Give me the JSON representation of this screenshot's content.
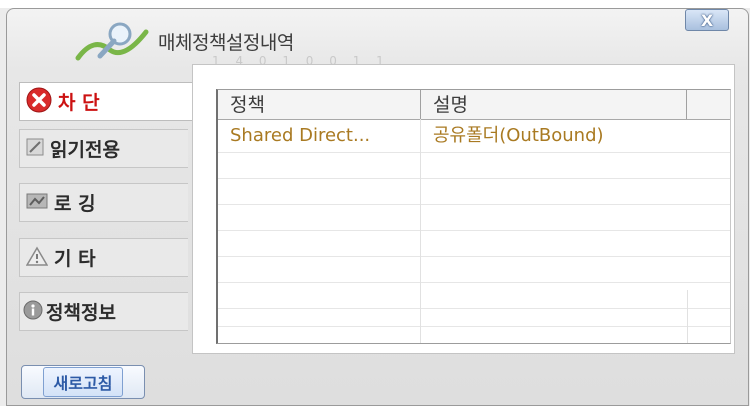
{
  "window": {
    "title": "매체정책설정내역",
    "title_shadow": "1 4 0 1 0 0 1 1",
    "close_label": "X"
  },
  "sidebar": {
    "items": [
      {
        "id": "block",
        "label": "차 단",
        "icon": "block-icon",
        "active": true
      },
      {
        "id": "readonly",
        "label": "읽기전용",
        "icon": "readonly-icon",
        "active": false
      },
      {
        "id": "logging",
        "label": "로 깅",
        "icon": "logging-icon",
        "active": false
      },
      {
        "id": "etc",
        "label": "기 타",
        "icon": "warning-icon",
        "active": false
      },
      {
        "id": "policyinfo",
        "label": "정책정보",
        "icon": "info-icon",
        "active": false
      }
    ]
  },
  "table": {
    "columns": [
      "정책",
      "설명"
    ],
    "rows": [
      {
        "policy": "Shared Direct...",
        "description": "공유폴더(OutBound)"
      }
    ]
  },
  "footer": {
    "refresh_label": "새로고침"
  },
  "colors": {
    "active_label": "#cc1111",
    "cell_text": "#a97a22",
    "refresh_text": "#2d5aa6"
  }
}
